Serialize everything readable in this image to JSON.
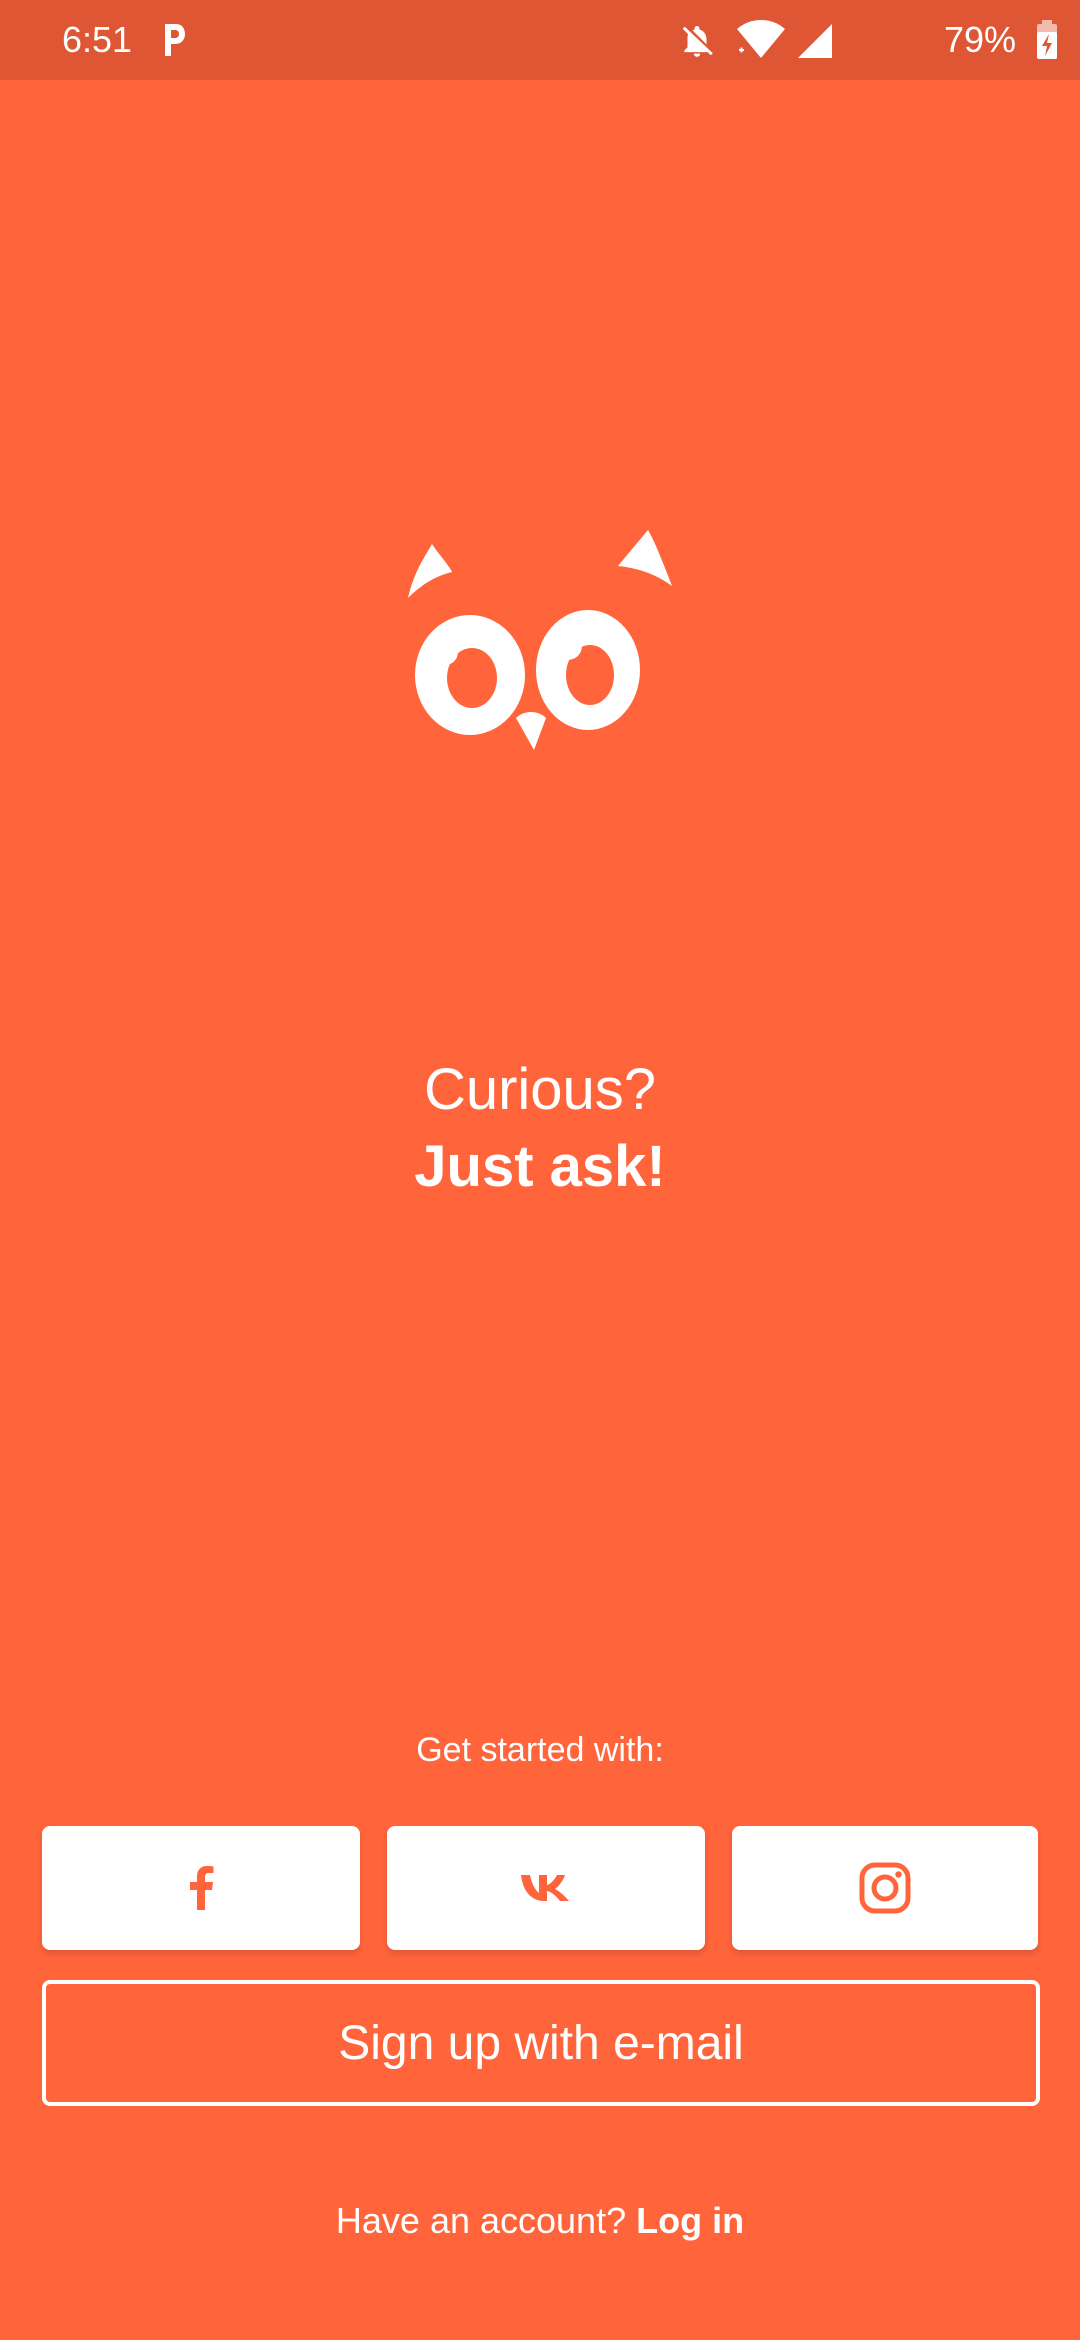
{
  "status_bar": {
    "time": "6:51",
    "battery": "79%",
    "icons": [
      "parking-app-icon",
      "bell-off-icon",
      "wifi-icon",
      "signal-icon",
      "battery-charging-icon"
    ]
  },
  "colors": {
    "background": "#ff643b",
    "status_bar": "#de5634",
    "button_background": "#ffffff",
    "accent": "#ff643b"
  },
  "logo": {
    "icon": "owl-face-logo"
  },
  "tagline": {
    "line1": "Curious?",
    "line2": "Just ask!"
  },
  "auth": {
    "get_started_label": "Get started with:",
    "social_buttons": [
      {
        "name": "facebook",
        "icon": "facebook-icon"
      },
      {
        "name": "vk",
        "icon": "vk-icon"
      },
      {
        "name": "instagram",
        "icon": "instagram-icon"
      }
    ],
    "email_button_label": "Sign up with e-mail",
    "account_prompt": "Have an account?",
    "login_label": "Log in"
  }
}
